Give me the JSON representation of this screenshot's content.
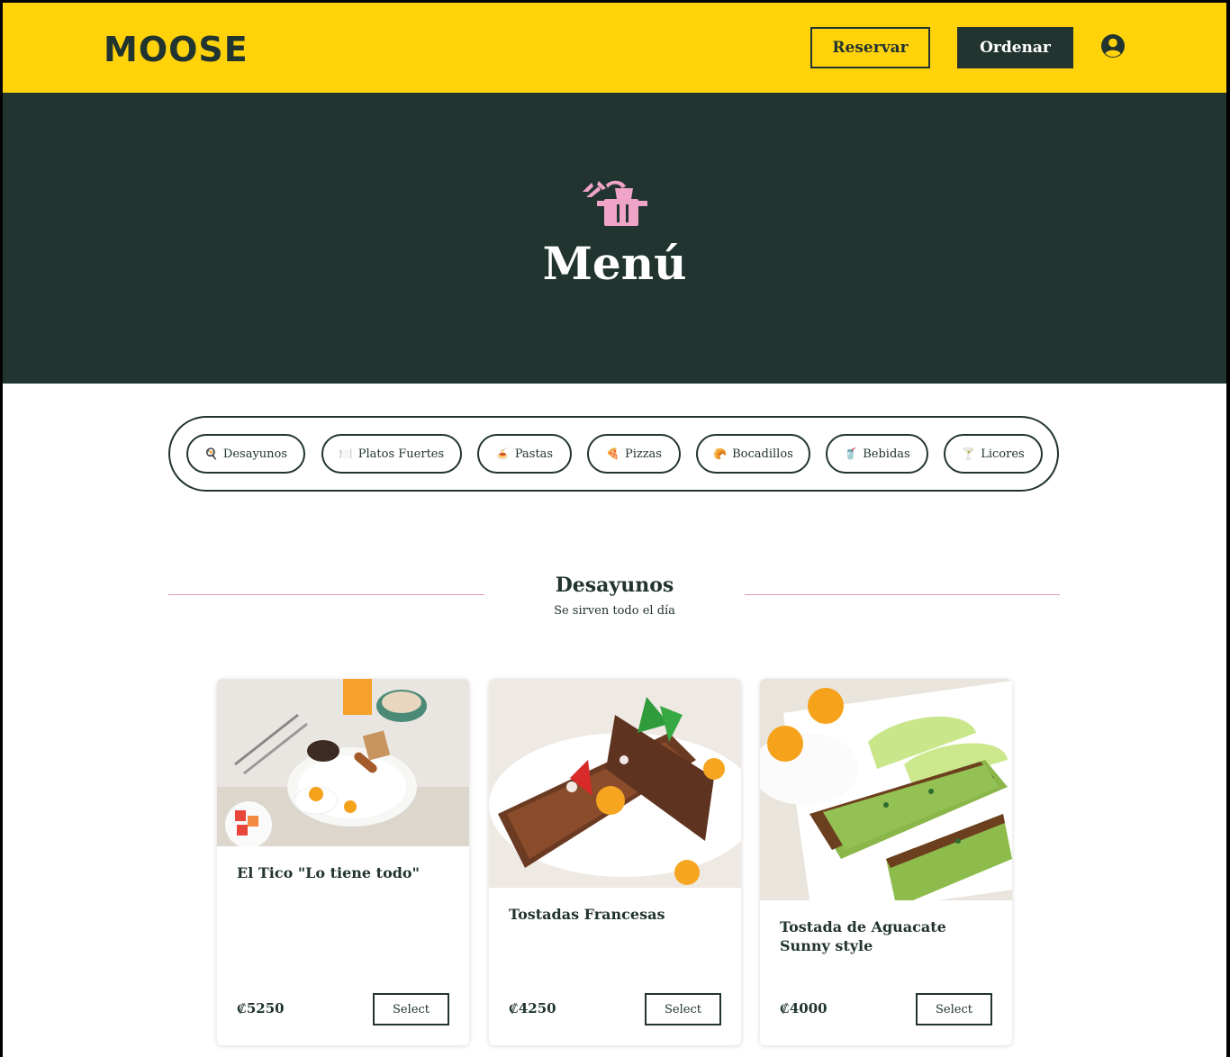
{
  "header": {
    "logo": "MOOSE",
    "reserve_label": "Reservar",
    "order_label": "Ordenar"
  },
  "hero": {
    "title": "Menú"
  },
  "categories": [
    {
      "label": "Desayunos",
      "icon": "🍳"
    },
    {
      "label": "Platos Fuertes",
      "icon": "🍽️"
    },
    {
      "label": "Pastas",
      "icon": "🍝"
    },
    {
      "label": "Pizzas",
      "icon": "🍕"
    },
    {
      "label": "Bocadillos",
      "icon": "🥐"
    },
    {
      "label": "Bebidas",
      "icon": "🥤"
    },
    {
      "label": "Licores",
      "icon": "🍸"
    }
  ],
  "section": {
    "title": "Desayunos",
    "subtitle": "Se sirven todo el día"
  },
  "cards": [
    {
      "title": "El Tico \"Lo tiene todo\"",
      "price": "₡5250",
      "button": "Select"
    },
    {
      "title": "Tostadas Francesas",
      "price": "₡4250",
      "button": "Select"
    },
    {
      "title": "Tostada de Aguacate Sunny style",
      "price": "₡4000",
      "button": "Select"
    }
  ],
  "colors": {
    "brand_yellow": "#ffd20a",
    "brand_dark": "#213430",
    "accent_pink": "#e8a0a8"
  }
}
